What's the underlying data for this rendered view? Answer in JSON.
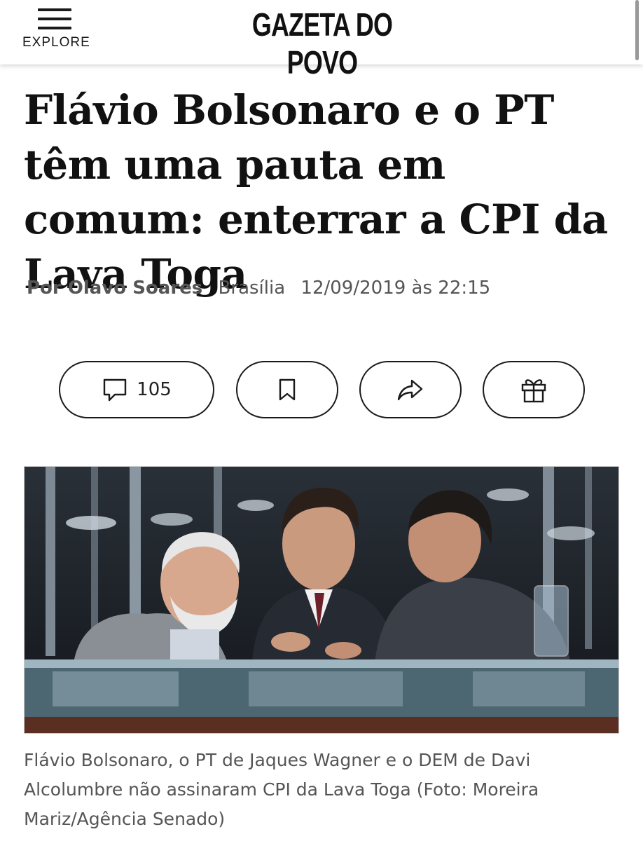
{
  "header": {
    "menu_label": "EXPLORE",
    "logo_text": "GAZETA DO POVO"
  },
  "article": {
    "headline": "Flávio Bolsonaro e o PT têm uma pauta em comum: enterrar a CPI da Lava Toga",
    "author": "Por Olavo Soares",
    "location": "Brasília",
    "datetime": "12/09/2019 às 22:15",
    "caption": "Flávio Bolsonaro, o PT de Jaques Wagner e o DEM de Davi Alcolumbre não assinaram CPI da Lava Toga (Foto: Moreira Mariz/Agência Senado)"
  },
  "actions": {
    "comments_count": "105",
    "icons": [
      "comment-icon",
      "bookmark-icon",
      "share-icon",
      "gift-icon"
    ]
  }
}
